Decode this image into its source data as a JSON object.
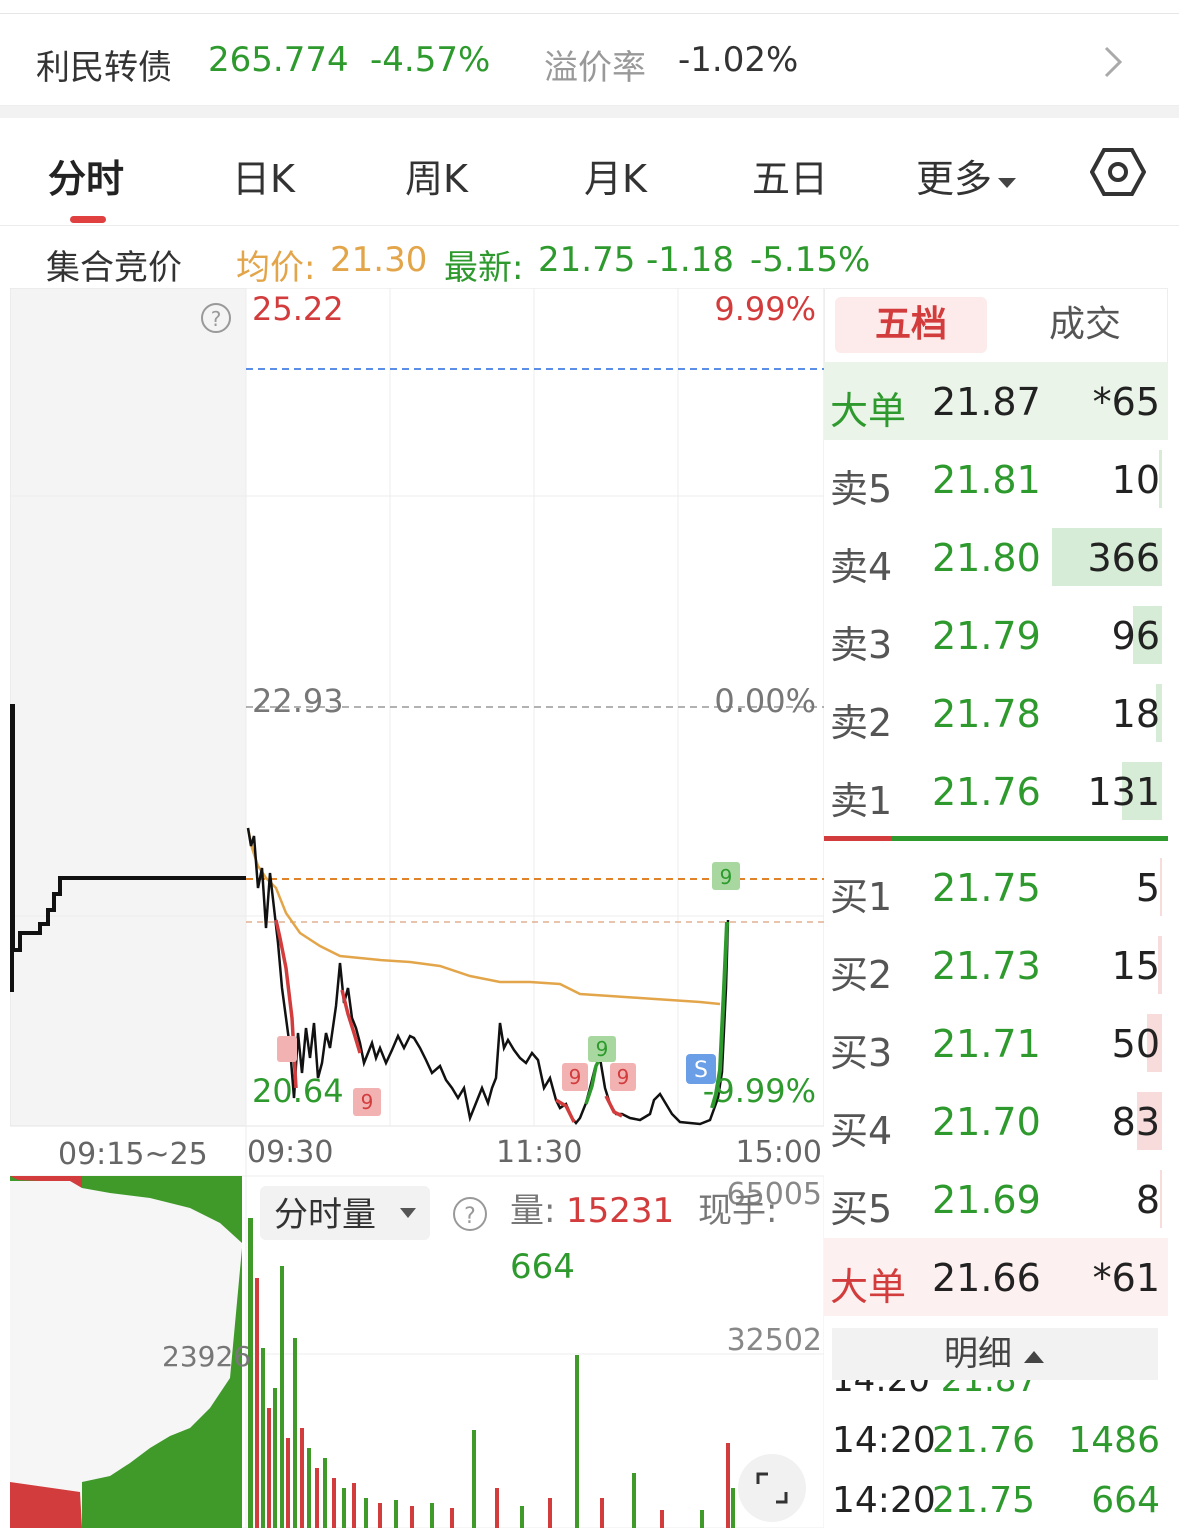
{
  "bond": {
    "name": "利民转债",
    "price": "265.774",
    "change_pct": "-4.57%",
    "premium_label": "溢价率",
    "premium_value": "-1.02%"
  },
  "tabs": [
    "分时",
    "日K",
    "周K",
    "月K",
    "五日",
    "更多"
  ],
  "info": {
    "auction": "集合竞价",
    "avg_label": "均价:",
    "avg_value": "21.30",
    "last_label": "最新:",
    "last_value": "21.75",
    "change": "-1.18",
    "change_pct": "-5.15%"
  },
  "chart": {
    "price_high": "25.22",
    "pct_high": "9.99%",
    "price_mid": "22.93",
    "pct_mid": "0.00%",
    "price_low": "20.64",
    "pct_low": "-9.99%",
    "time_auction": "09:15~25",
    "time_open": "09:30",
    "time_mid": "11:30",
    "time_close": "15:00",
    "vol_label": "分时量",
    "vol_field": "量:",
    "vol_value": "15231",
    "hand_field": "现手:",
    "hand_value": "664",
    "vol_max": "65005",
    "vol_mid": "32502",
    "auction_vol": "23926",
    "marker_nine": "9",
    "marker_s": "S"
  },
  "orderbook": {
    "tab_five": "五档",
    "tab_trade": "成交",
    "big_ask": {
      "label": "大单",
      "price": "21.87",
      "vol": "*65"
    },
    "asks": [
      {
        "label": "卖5",
        "price": "21.81",
        "vol": "10",
        "fill": 0.03
      },
      {
        "label": "卖4",
        "price": "21.80",
        "vol": "366",
        "fill": 1.0
      },
      {
        "label": "卖3",
        "price": "21.79",
        "vol": "96",
        "fill": 0.26
      },
      {
        "label": "卖2",
        "price": "21.78",
        "vol": "18",
        "fill": 0.05
      },
      {
        "label": "卖1",
        "price": "21.76",
        "vol": "131",
        "fill": 0.36
      }
    ],
    "bids": [
      {
        "label": "买1",
        "price": "21.75",
        "vol": "5",
        "fill": 0.02
      },
      {
        "label": "买2",
        "price": "21.73",
        "vol": "15",
        "fill": 0.04
      },
      {
        "label": "买3",
        "price": "21.71",
        "vol": "50",
        "fill": 0.14
      },
      {
        "label": "买4",
        "price": "21.70",
        "vol": "83",
        "fill": 0.23
      },
      {
        "label": "买5",
        "price": "21.69",
        "vol": "8",
        "fill": 0.02
      }
    ],
    "big_bid": {
      "label": "大单",
      "price": "21.66",
      "vol": "*61"
    },
    "detail_label": "明细",
    "trades": [
      {
        "time": "14:20",
        "price": "21.76",
        "vol": "1486"
      },
      {
        "time": "14:20",
        "price": "21.75",
        "vol": "664"
      }
    ]
  },
  "colors": {
    "up": "#d23c3c",
    "down": "#2e9a2e",
    "avg": "#e3a54a",
    "ref": "#5b8ee6"
  }
}
